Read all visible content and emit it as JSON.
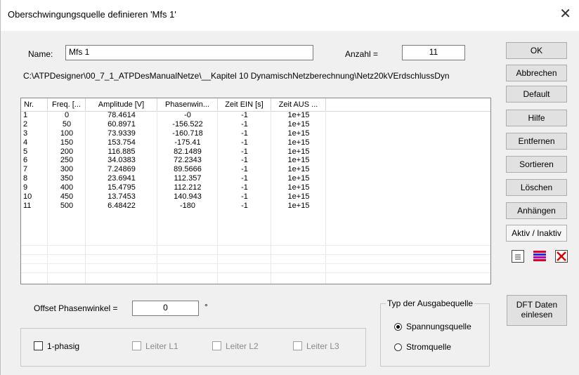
{
  "window": {
    "title": "Oberschwingungsquelle definieren 'Mfs 1'",
    "close_glyph": "✕"
  },
  "form": {
    "name_label": "Name:",
    "name_value": "Mfs 1",
    "count_label": "Anzahl =",
    "count_value": "11",
    "path": "C:\\ATPDesigner\\00_7_1_ATPDesManualNetze\\__Kapitel 10 DynamischNetzberechnung\\Netz20kVErdschlussDyn"
  },
  "table": {
    "headers": [
      "Nr.",
      "Freq. [...",
      "Amplitude [V]",
      "Phasenwin...",
      "Zeit EIN [s]",
      "Zeit AUS ..."
    ],
    "rows": [
      [
        "1",
        "0",
        "78.4614",
        "-0",
        "-1",
        "1e+15"
      ],
      [
        "2",
        "50",
        "60.8971",
        "-156.522",
        "-1",
        "1e+15"
      ],
      [
        "3",
        "100",
        "73.9339",
        "-160.718",
        "-1",
        "1e+15"
      ],
      [
        "4",
        "150",
        "153.754",
        "-175.41",
        "-1",
        "1e+15"
      ],
      [
        "5",
        "200",
        "116.885",
        "82.1489",
        "-1",
        "1e+15"
      ],
      [
        "6",
        "250",
        "34.0383",
        "72.2343",
        "-1",
        "1e+15"
      ],
      [
        "7",
        "300",
        "7.24869",
        "89.5666",
        "-1",
        "1e+15"
      ],
      [
        "8",
        "350",
        "23.6941",
        "112.357",
        "-1",
        "1e+15"
      ],
      [
        "9",
        "400",
        "15.4795",
        "112.212",
        "-1",
        "1e+15"
      ],
      [
        "10",
        "450",
        "13.7453",
        "140.943",
        "-1",
        "1e+15"
      ],
      [
        "11",
        "500",
        "6.48422",
        "-180",
        "-1",
        "1e+15"
      ]
    ]
  },
  "buttons": {
    "ok": "OK",
    "cancel": "Abbrechen",
    "default": "Default",
    "help": "Hilfe",
    "remove": "Entfernen",
    "sort": "Sortieren",
    "delete": "Löschen",
    "append": "Anhängen",
    "toggle_active": "Aktiv / Inaktiv",
    "dft_line1": "DFT Daten",
    "dft_line2": "einlesen"
  },
  "icons": {
    "list": "list-icon",
    "color_bars": "color-bars-icon",
    "delete_x": "delete-x-icon"
  },
  "colors": {
    "bar_red": "#e0002a",
    "bar_blue": "#2a2ad0",
    "bar_magenta": "#c000c0",
    "x_red": "#e00000"
  },
  "offset": {
    "label": "Offset Phasenwinkel =",
    "value": "0",
    "unit": "°"
  },
  "phases": {
    "single": "1-phasig",
    "l1": "Leiter L1",
    "l2": "Leiter L2",
    "l3": "Leiter L3"
  },
  "output_type": {
    "title": "Typ der Ausgabequelle",
    "voltage": "Spannungsquelle",
    "current": "Stromquelle"
  }
}
